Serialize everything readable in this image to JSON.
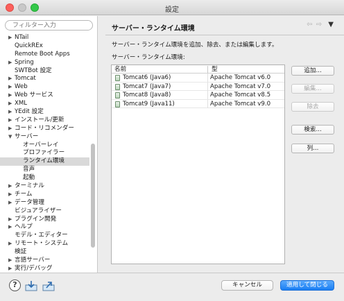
{
  "window": {
    "title": "設定"
  },
  "sidebar": {
    "filter_placeholder": "フィルター入力",
    "items": [
      {
        "label": "NTail",
        "level": 0,
        "expandable": true,
        "selected": false
      },
      {
        "label": "QuickREx",
        "level": 0,
        "expandable": false,
        "selected": false
      },
      {
        "label": "Remote Boot Apps",
        "level": 0,
        "expandable": false,
        "selected": false
      },
      {
        "label": "Spring",
        "level": 0,
        "expandable": true,
        "selected": false
      },
      {
        "label": "SWTBot 設定",
        "level": 0,
        "expandable": false,
        "selected": false
      },
      {
        "label": "Tomcat",
        "level": 0,
        "expandable": true,
        "selected": false
      },
      {
        "label": "Web",
        "level": 0,
        "expandable": true,
        "selected": false
      },
      {
        "label": "Web サービス",
        "level": 0,
        "expandable": true,
        "selected": false
      },
      {
        "label": "XML",
        "level": 0,
        "expandable": true,
        "selected": false
      },
      {
        "label": "YEdit 設定",
        "level": 0,
        "expandable": true,
        "selected": false
      },
      {
        "label": "インストール/更新",
        "level": 0,
        "expandable": true,
        "selected": false
      },
      {
        "label": "コード・リコメンダー",
        "level": 0,
        "expandable": true,
        "selected": false
      },
      {
        "label": "サーバー",
        "level": 0,
        "expandable": true,
        "expanded": true,
        "selected": false
      },
      {
        "label": "オーバーレイ",
        "level": 1,
        "expandable": false,
        "selected": false
      },
      {
        "label": "プロファイラー",
        "level": 1,
        "expandable": false,
        "selected": false
      },
      {
        "label": "ランタイム環境",
        "level": 1,
        "expandable": false,
        "selected": true
      },
      {
        "label": "音声",
        "level": 1,
        "expandable": false,
        "selected": false
      },
      {
        "label": "起動",
        "level": 1,
        "expandable": false,
        "selected": false
      },
      {
        "label": "ターミナル",
        "level": 0,
        "expandable": true,
        "selected": false
      },
      {
        "label": "チーム",
        "level": 0,
        "expandable": true,
        "selected": false
      },
      {
        "label": "データ管理",
        "level": 0,
        "expandable": true,
        "selected": false
      },
      {
        "label": "ビジュアライザー",
        "level": 0,
        "expandable": false,
        "selected": false
      },
      {
        "label": "プラグイン開発",
        "level": 0,
        "expandable": true,
        "selected": false
      },
      {
        "label": "ヘルプ",
        "level": 0,
        "expandable": true,
        "selected": false
      },
      {
        "label": "モデル・エディター",
        "level": 0,
        "expandable": false,
        "selected": false
      },
      {
        "label": "リモート・システム",
        "level": 0,
        "expandable": true,
        "selected": false
      },
      {
        "label": "検証",
        "level": 0,
        "expandable": false,
        "selected": false
      },
      {
        "label": "言語サーバー",
        "level": 0,
        "expandable": true,
        "selected": false
      },
      {
        "label": "実行/デバッグ",
        "level": 0,
        "expandable": true,
        "selected": false
      }
    ]
  },
  "main": {
    "title": "サーバー・ランタイム環境",
    "nav_back": "⇦",
    "nav_forward": "⇨",
    "nav_menu": "▼",
    "description": "サーバー・ランタイム環境を追加、除去、または編集します。",
    "list_label": "サーバー・ランタイム環境:",
    "table": {
      "headers": [
        "名前",
        "型"
      ],
      "rows": [
        {
          "name": "Tomcat6 (Java6)",
          "type": "Apache Tomcat v6.0"
        },
        {
          "name": "Tomcat7 (Java7)",
          "type": "Apache Tomcat v7.0"
        },
        {
          "name": "Tomcat8 (Java8)",
          "type": "Apache Tomcat v8.5"
        },
        {
          "name": "Tomcat9 (Java11)",
          "type": "Apache Tomcat v9.0"
        }
      ]
    },
    "buttons": {
      "add": "追加...",
      "edit": "編集...",
      "remove": "除去",
      "search": "検索...",
      "columns": "列..."
    }
  },
  "footer": {
    "help": "?",
    "cancel": "キャンセル",
    "apply_close": "適用して閉じる"
  },
  "colors": {
    "accent": "#1a7ef3",
    "selection": "#d9d9d9"
  }
}
